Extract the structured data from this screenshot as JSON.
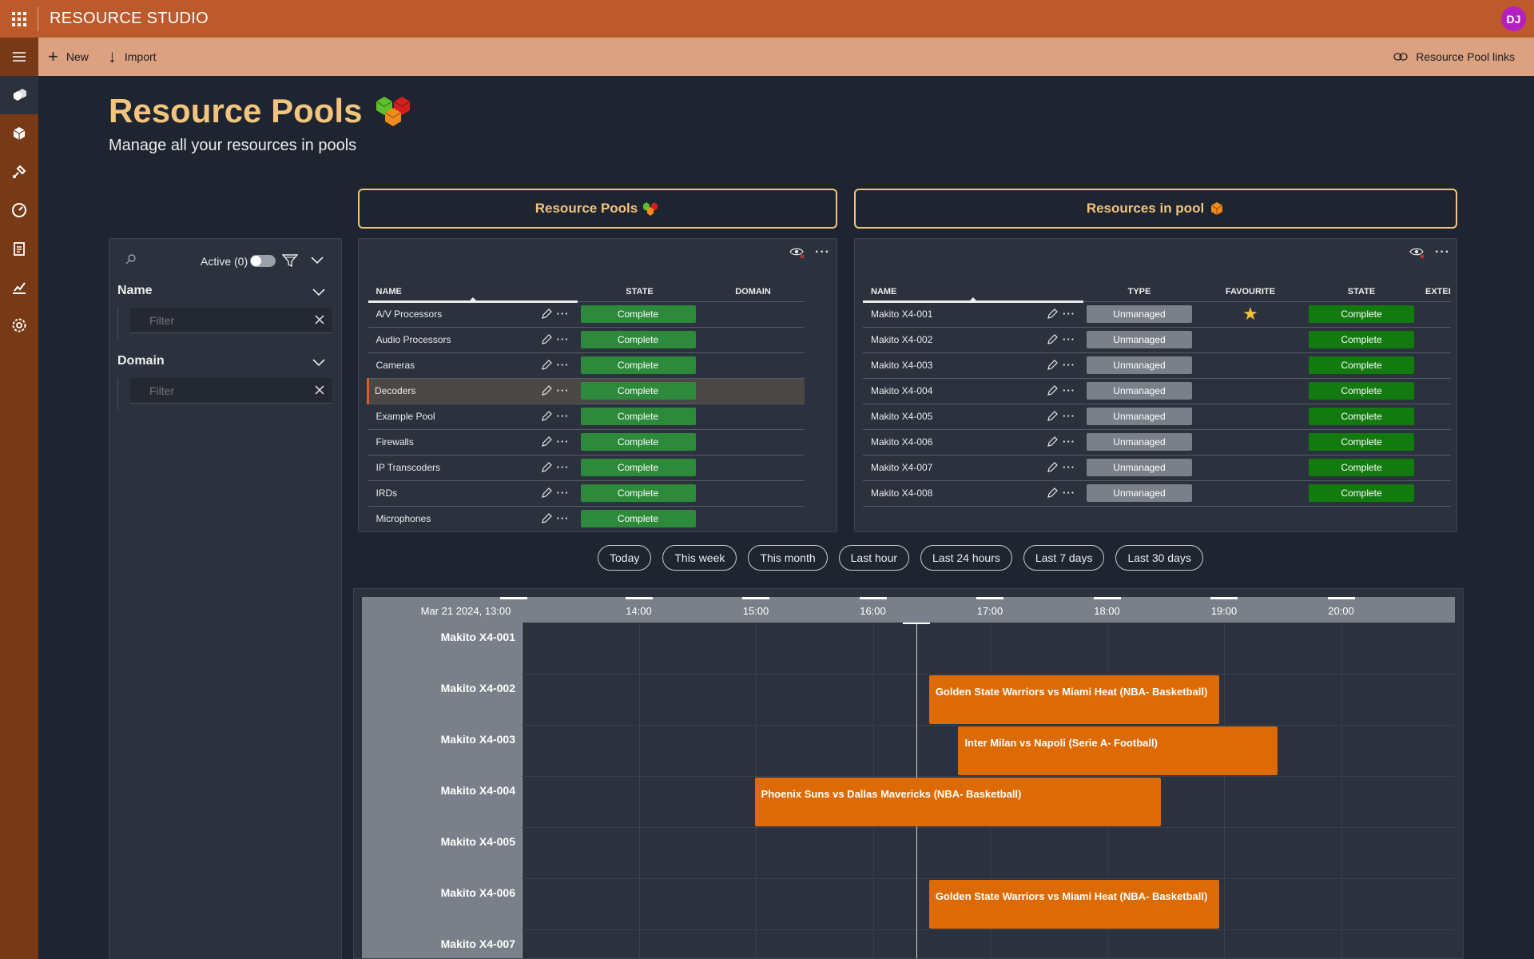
{
  "app": {
    "title": "RESOURCE STUDIO",
    "user_initials": "DJ",
    "avatar_color": "#b51fc2",
    "accent_color": "#bc5a2b"
  },
  "commands": {
    "new_label": "New",
    "import_label": "Import",
    "links_label": "Resource Pool links"
  },
  "nav": [
    "resource-pools-icon",
    "resources-icon",
    "capabilities-icon",
    "dashboard-icon",
    "jobs-icon",
    "reports-icon",
    "settings-icon"
  ],
  "header": {
    "title": "Resource Pools",
    "subtitle": "Manage all your resources in pools"
  },
  "tabs": {
    "pools": "Resource Pools",
    "resources": "Resources in pool"
  },
  "filters": {
    "active_label": "Active (0)",
    "name_label": "Name",
    "name_placeholder": "Filter",
    "domain_label": "Domain",
    "domain_placeholder": "Filter"
  },
  "pools_grid": {
    "columns": [
      "NAME",
      "STATE",
      "DOMAIN"
    ],
    "rows": [
      {
        "name": "A/V Processors",
        "state": "Complete",
        "domain": ""
      },
      {
        "name": "Audio Processors",
        "state": "Complete",
        "domain": ""
      },
      {
        "name": "Cameras",
        "state": "Complete",
        "domain": ""
      },
      {
        "name": "Decoders",
        "state": "Complete",
        "domain": "",
        "selected": true
      },
      {
        "name": "Example Pool",
        "state": "Complete",
        "domain": ""
      },
      {
        "name": "Firewalls",
        "state": "Complete",
        "domain": ""
      },
      {
        "name": "IP Transcoders",
        "state": "Complete",
        "domain": ""
      },
      {
        "name": "IRDs",
        "state": "Complete",
        "domain": ""
      },
      {
        "name": "Microphones",
        "state": "Complete",
        "domain": ""
      }
    ]
  },
  "resources_grid": {
    "columns": [
      "NAME",
      "TYPE",
      "FAVOURITE",
      "STATE",
      "EXTEI"
    ],
    "rows": [
      {
        "name": "Makito X4-001",
        "type": "Unmanaged",
        "favourite": true,
        "state": "Complete"
      },
      {
        "name": "Makito X4-002",
        "type": "Unmanaged",
        "favourite": false,
        "state": "Complete"
      },
      {
        "name": "Makito X4-003",
        "type": "Unmanaged",
        "favourite": false,
        "state": "Complete"
      },
      {
        "name": "Makito X4-004",
        "type": "Unmanaged",
        "favourite": false,
        "state": "Complete"
      },
      {
        "name": "Makito X4-005",
        "type": "Unmanaged",
        "favourite": false,
        "state": "Complete"
      },
      {
        "name": "Makito X4-006",
        "type": "Unmanaged",
        "favourite": false,
        "state": "Complete"
      },
      {
        "name": "Makito X4-007",
        "type": "Unmanaged",
        "favourite": false,
        "state": "Complete"
      },
      {
        "name": "Makito X4-008",
        "type": "Unmanaged",
        "favourite": false,
        "state": "Complete"
      }
    ]
  },
  "time_ranges": [
    "Today",
    "This week",
    "This month",
    "Last hour",
    "Last 24 hours",
    "Last 7 days",
    "Last 30 days"
  ],
  "timeline": {
    "ticks": [
      {
        "label": "Mar 21 2024, 13:00",
        "hour": 13
      },
      {
        "label": "14:00",
        "hour": 14
      },
      {
        "label": "15:00",
        "hour": 15
      },
      {
        "label": "16:00",
        "hour": 16
      },
      {
        "label": "17:00",
        "hour": 17
      },
      {
        "label": "18:00",
        "hour": 18
      },
      {
        "label": "19:00",
        "hour": 19
      },
      {
        "label": "20:00",
        "hour": 20
      }
    ],
    "now_hour": 16.37,
    "resources": [
      "Makito X4-001",
      "Makito X4-002",
      "Makito X4-003",
      "Makito X4-004",
      "Makito X4-005",
      "Makito X4-006",
      "Makito X4-007"
    ],
    "events": [
      {
        "row": 1,
        "title": "Golden State Warriors vs Miami Heat (NBA- Basketball)",
        "start": 16.48,
        "end": 18.96
      },
      {
        "row": 2,
        "title": "Inter Milan vs Napoli (Serie A- Football)",
        "start": 16.73,
        "end": 19.46
      },
      {
        "row": 3,
        "title": "Phoenix Suns vs Dallas Mavericks (NBA- Basketball)",
        "start": 14.99,
        "end": 18.46
      },
      {
        "row": 5,
        "title": "Golden State Warriors vs Miami Heat (NBA- Basketball)",
        "start": 16.48,
        "end": 18.96
      }
    ]
  }
}
